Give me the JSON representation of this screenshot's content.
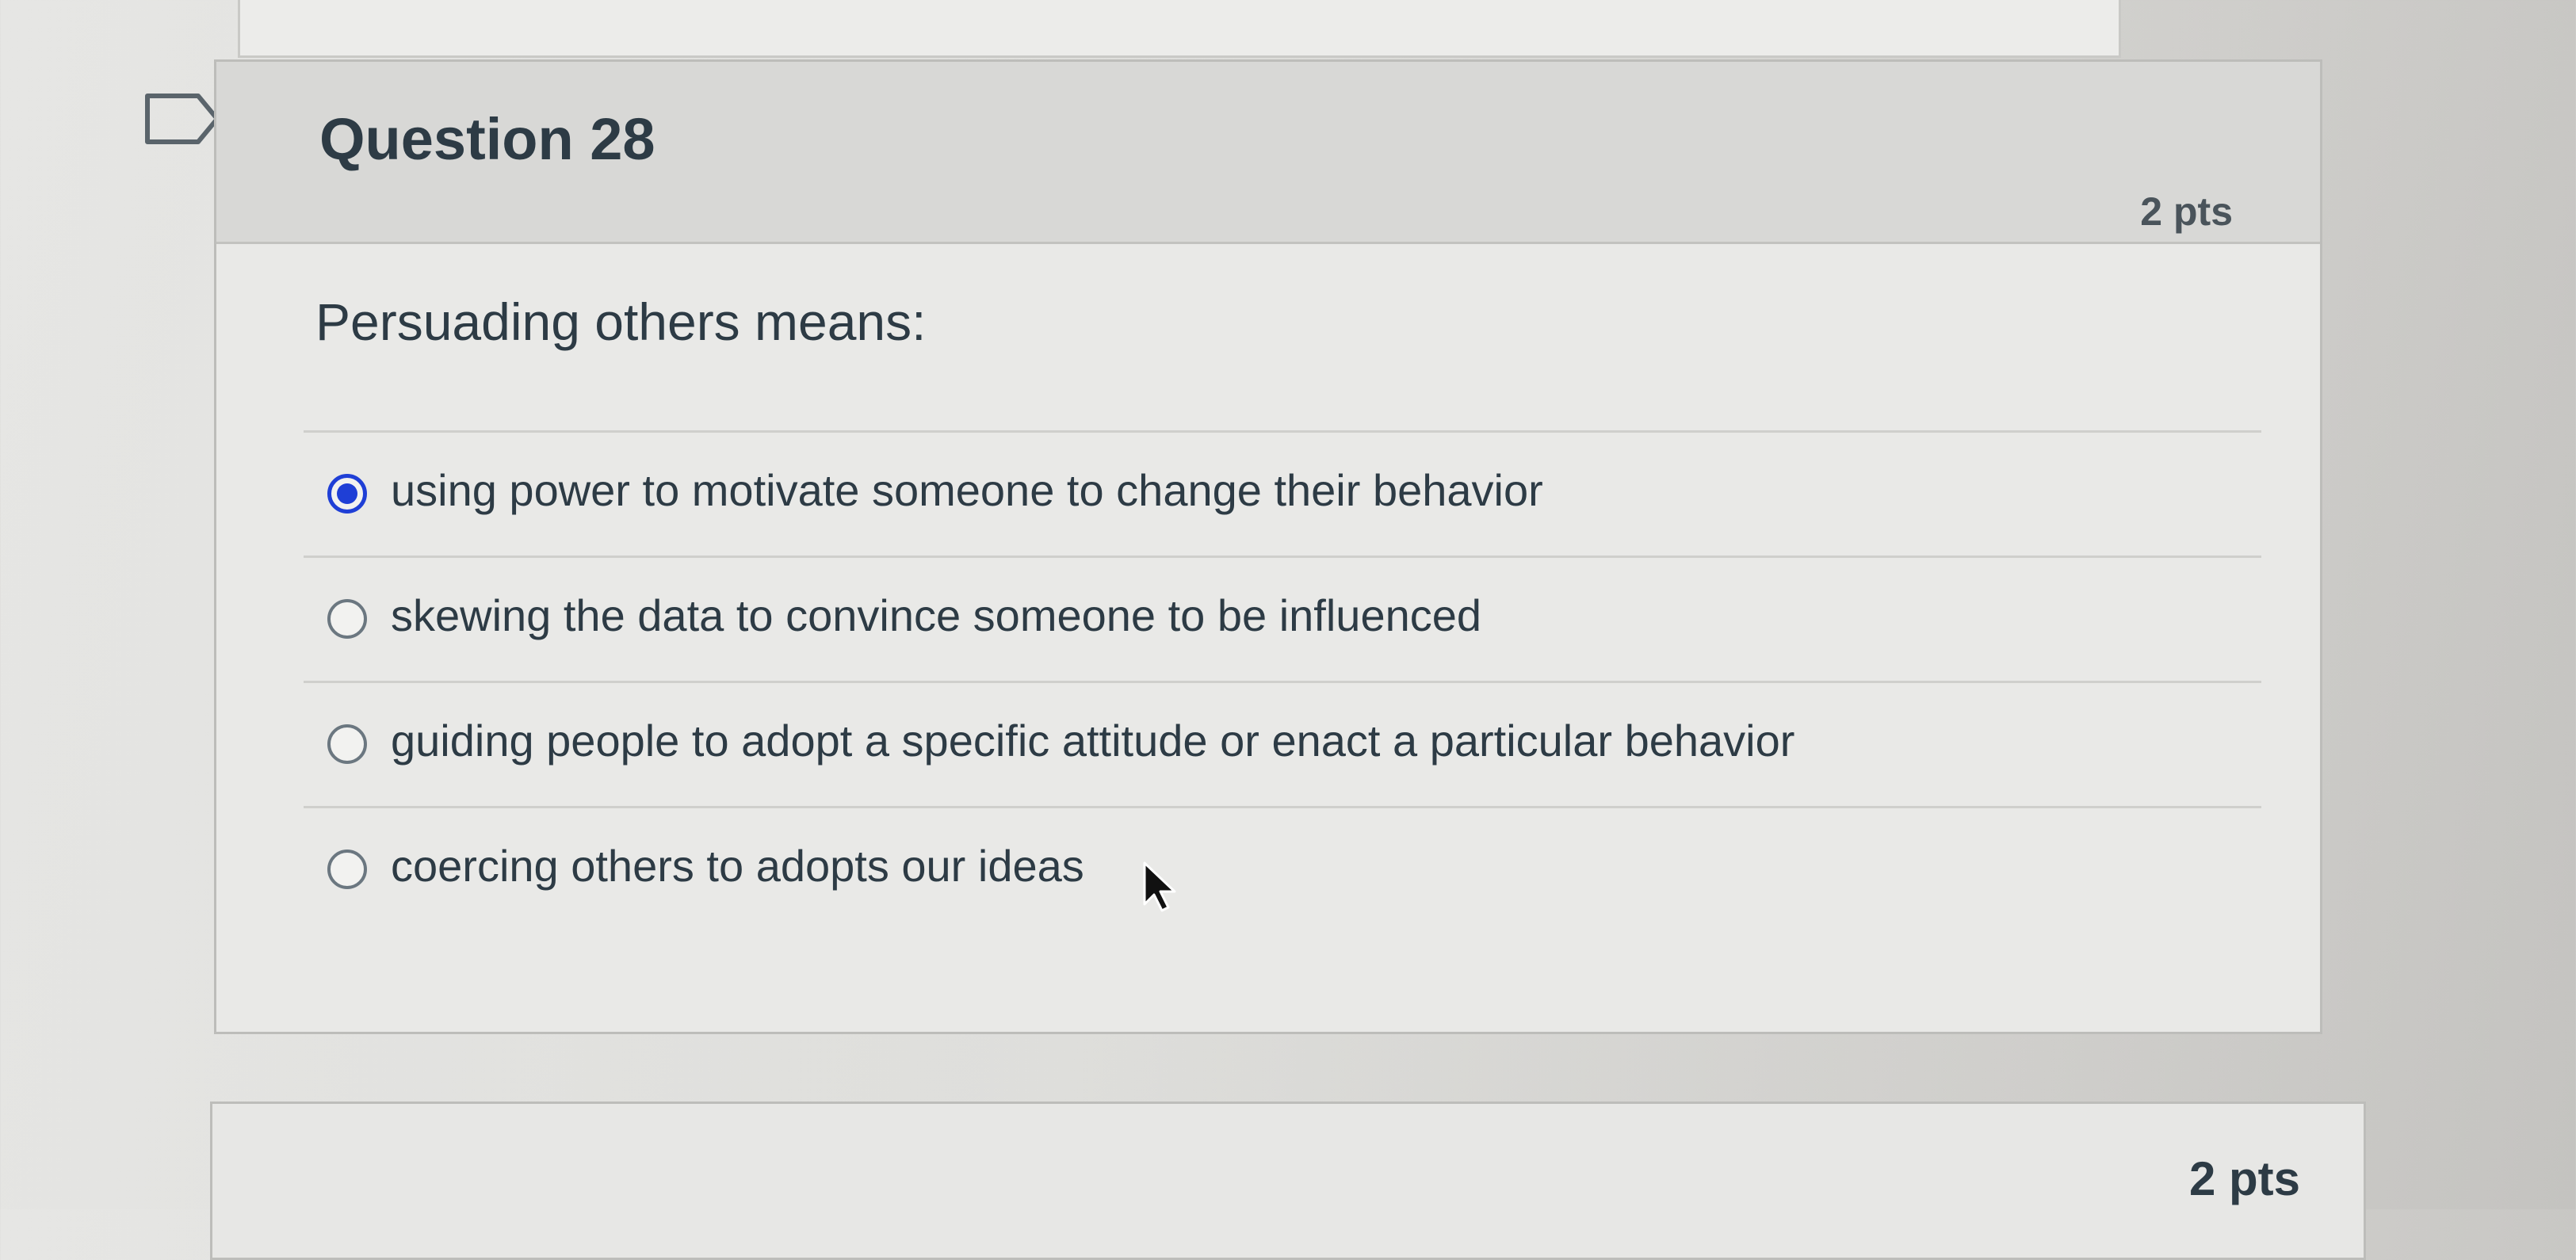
{
  "question": {
    "title": "Question 28",
    "points": "2 pts",
    "prompt": "Persuading others means:",
    "answers": [
      {
        "label": "using power to motivate someone to change their behavior",
        "selected": true
      },
      {
        "label": "skewing the data to convince someone to be influenced",
        "selected": false
      },
      {
        "label": "guiding people to adopt a specific attitude or enact a particular behavior",
        "selected": false
      },
      {
        "label": "coercing others to adopts our ideas",
        "selected": false
      }
    ]
  },
  "next_question": {
    "points": "2 pts"
  },
  "colors": {
    "radio_selected": "#1f3fd6",
    "text": "#2d3b45"
  },
  "icons": {
    "flag": "flag-icon",
    "cursor": "mouse-pointer-icon"
  }
}
